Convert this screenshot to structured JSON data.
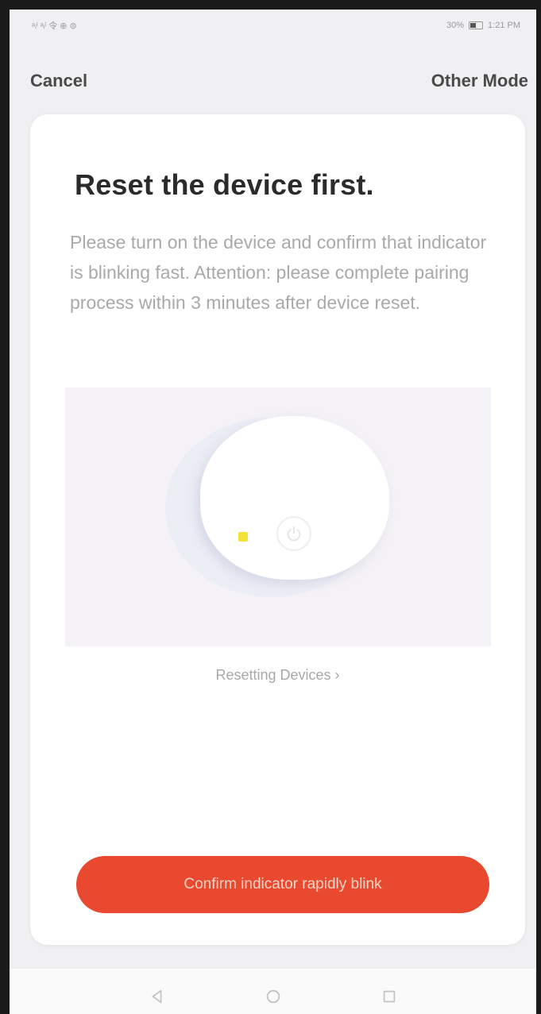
{
  "status_bar": {
    "left_text": "ᵃᵢˡ ᵃᵢˡ 令 ⊕ ⊜",
    "right_text": "30%",
    "time": "1:21 PM"
  },
  "nav": {
    "cancel_label": "Cancel",
    "other_mode_label": "Other Mode"
  },
  "card": {
    "title": "Reset the device first.",
    "description": "Please turn on the device and confirm that indicator is blinking fast. Attention: please complete pairing process within 3 minutes after device reset.",
    "reset_link": "Resetting Devices  ›",
    "confirm_label": "Confirm indicator rapidly blink"
  },
  "colors": {
    "accent": "#e8492f",
    "indicator": "#f3e23a"
  },
  "icons": {
    "back": "back-triangle-icon",
    "home": "home-circle-icon",
    "recents": "recents-square-icon",
    "power": "power-icon"
  }
}
